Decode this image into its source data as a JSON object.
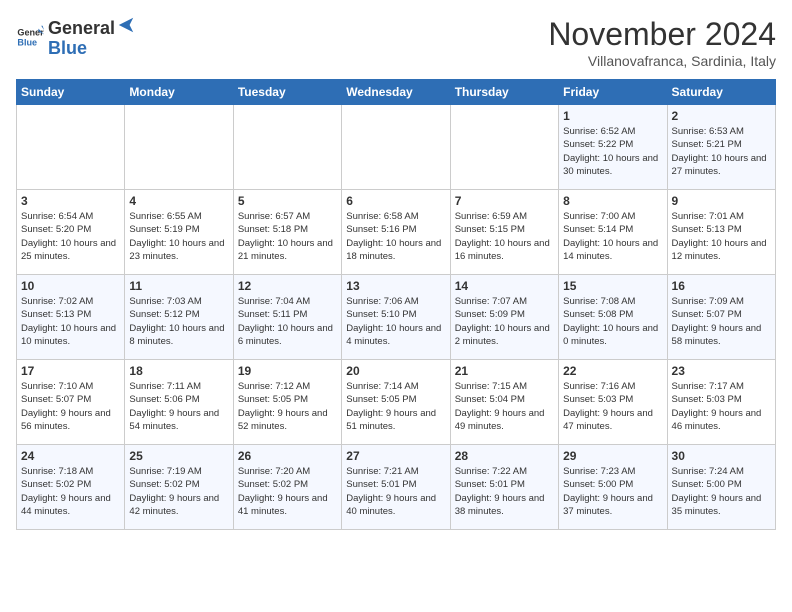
{
  "header": {
    "logo_general": "General",
    "logo_blue": "Blue",
    "month": "November 2024",
    "location": "Villanovafranca, Sardinia, Italy"
  },
  "days_of_week": [
    "Sunday",
    "Monday",
    "Tuesday",
    "Wednesday",
    "Thursday",
    "Friday",
    "Saturday"
  ],
  "weeks": [
    [
      {
        "day": "",
        "info": ""
      },
      {
        "day": "",
        "info": ""
      },
      {
        "day": "",
        "info": ""
      },
      {
        "day": "",
        "info": ""
      },
      {
        "day": "",
        "info": ""
      },
      {
        "day": "1",
        "info": "Sunrise: 6:52 AM\nSunset: 5:22 PM\nDaylight: 10 hours and 30 minutes."
      },
      {
        "day": "2",
        "info": "Sunrise: 6:53 AM\nSunset: 5:21 PM\nDaylight: 10 hours and 27 minutes."
      }
    ],
    [
      {
        "day": "3",
        "info": "Sunrise: 6:54 AM\nSunset: 5:20 PM\nDaylight: 10 hours and 25 minutes."
      },
      {
        "day": "4",
        "info": "Sunrise: 6:55 AM\nSunset: 5:19 PM\nDaylight: 10 hours and 23 minutes."
      },
      {
        "day": "5",
        "info": "Sunrise: 6:57 AM\nSunset: 5:18 PM\nDaylight: 10 hours and 21 minutes."
      },
      {
        "day": "6",
        "info": "Sunrise: 6:58 AM\nSunset: 5:16 PM\nDaylight: 10 hours and 18 minutes."
      },
      {
        "day": "7",
        "info": "Sunrise: 6:59 AM\nSunset: 5:15 PM\nDaylight: 10 hours and 16 minutes."
      },
      {
        "day": "8",
        "info": "Sunrise: 7:00 AM\nSunset: 5:14 PM\nDaylight: 10 hours and 14 minutes."
      },
      {
        "day": "9",
        "info": "Sunrise: 7:01 AM\nSunset: 5:13 PM\nDaylight: 10 hours and 12 minutes."
      }
    ],
    [
      {
        "day": "10",
        "info": "Sunrise: 7:02 AM\nSunset: 5:13 PM\nDaylight: 10 hours and 10 minutes."
      },
      {
        "day": "11",
        "info": "Sunrise: 7:03 AM\nSunset: 5:12 PM\nDaylight: 10 hours and 8 minutes."
      },
      {
        "day": "12",
        "info": "Sunrise: 7:04 AM\nSunset: 5:11 PM\nDaylight: 10 hours and 6 minutes."
      },
      {
        "day": "13",
        "info": "Sunrise: 7:06 AM\nSunset: 5:10 PM\nDaylight: 10 hours and 4 minutes."
      },
      {
        "day": "14",
        "info": "Sunrise: 7:07 AM\nSunset: 5:09 PM\nDaylight: 10 hours and 2 minutes."
      },
      {
        "day": "15",
        "info": "Sunrise: 7:08 AM\nSunset: 5:08 PM\nDaylight: 10 hours and 0 minutes."
      },
      {
        "day": "16",
        "info": "Sunrise: 7:09 AM\nSunset: 5:07 PM\nDaylight: 9 hours and 58 minutes."
      }
    ],
    [
      {
        "day": "17",
        "info": "Sunrise: 7:10 AM\nSunset: 5:07 PM\nDaylight: 9 hours and 56 minutes."
      },
      {
        "day": "18",
        "info": "Sunrise: 7:11 AM\nSunset: 5:06 PM\nDaylight: 9 hours and 54 minutes."
      },
      {
        "day": "19",
        "info": "Sunrise: 7:12 AM\nSunset: 5:05 PM\nDaylight: 9 hours and 52 minutes."
      },
      {
        "day": "20",
        "info": "Sunrise: 7:14 AM\nSunset: 5:05 PM\nDaylight: 9 hours and 51 minutes."
      },
      {
        "day": "21",
        "info": "Sunrise: 7:15 AM\nSunset: 5:04 PM\nDaylight: 9 hours and 49 minutes."
      },
      {
        "day": "22",
        "info": "Sunrise: 7:16 AM\nSunset: 5:03 PM\nDaylight: 9 hours and 47 minutes."
      },
      {
        "day": "23",
        "info": "Sunrise: 7:17 AM\nSunset: 5:03 PM\nDaylight: 9 hours and 46 minutes."
      }
    ],
    [
      {
        "day": "24",
        "info": "Sunrise: 7:18 AM\nSunset: 5:02 PM\nDaylight: 9 hours and 44 minutes."
      },
      {
        "day": "25",
        "info": "Sunrise: 7:19 AM\nSunset: 5:02 PM\nDaylight: 9 hours and 42 minutes."
      },
      {
        "day": "26",
        "info": "Sunrise: 7:20 AM\nSunset: 5:02 PM\nDaylight: 9 hours and 41 minutes."
      },
      {
        "day": "27",
        "info": "Sunrise: 7:21 AM\nSunset: 5:01 PM\nDaylight: 9 hours and 40 minutes."
      },
      {
        "day": "28",
        "info": "Sunrise: 7:22 AM\nSunset: 5:01 PM\nDaylight: 9 hours and 38 minutes."
      },
      {
        "day": "29",
        "info": "Sunrise: 7:23 AM\nSunset: 5:00 PM\nDaylight: 9 hours and 37 minutes."
      },
      {
        "day": "30",
        "info": "Sunrise: 7:24 AM\nSunset: 5:00 PM\nDaylight: 9 hours and 35 minutes."
      }
    ]
  ]
}
